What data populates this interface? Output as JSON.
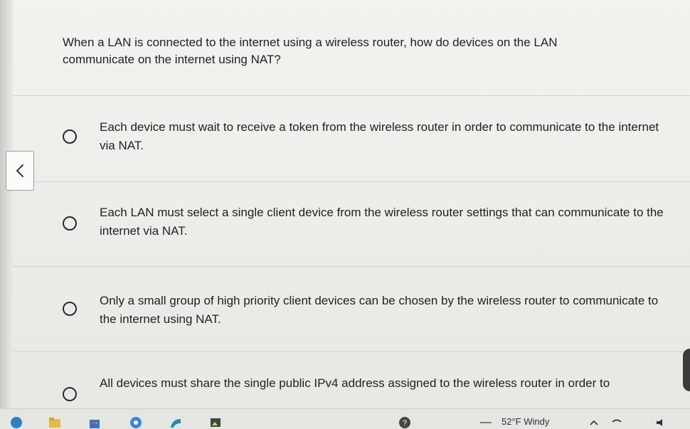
{
  "question": {
    "text": "When a LAN is connected to the internet using a wireless router, how do devices on the LAN communicate on the internet using NAT?"
  },
  "options": [
    {
      "label": "Each device must wait to receive a token from the wireless router in order to communicate to the internet via NAT."
    },
    {
      "label": "Each LAN must select a single client device from the wireless router settings that can communicate to the internet via NAT."
    },
    {
      "label": "Only a small group of high priority client devices can be chosen by the wireless router to communicate to the internet using NAT."
    },
    {
      "label": "All devices must share the single public IPv4 address assigned to the wireless router in order to"
    }
  ],
  "navigation": {
    "back_icon": "chevron-left-icon"
  },
  "taskbar": {
    "weather": "52°F Windy",
    "icons": [
      "start-icon",
      "file-explorer-icon",
      "store-icon",
      "chrome-icon",
      "edge-icon",
      "photos-icon",
      "help-icon",
      "chevron-up-icon",
      "wifi-icon",
      "volume-icon"
    ]
  },
  "colors": {
    "background": "#eef0ec",
    "text": "#222222",
    "radio_border": "#2b2b2b",
    "divider": "#cfd2cc"
  }
}
